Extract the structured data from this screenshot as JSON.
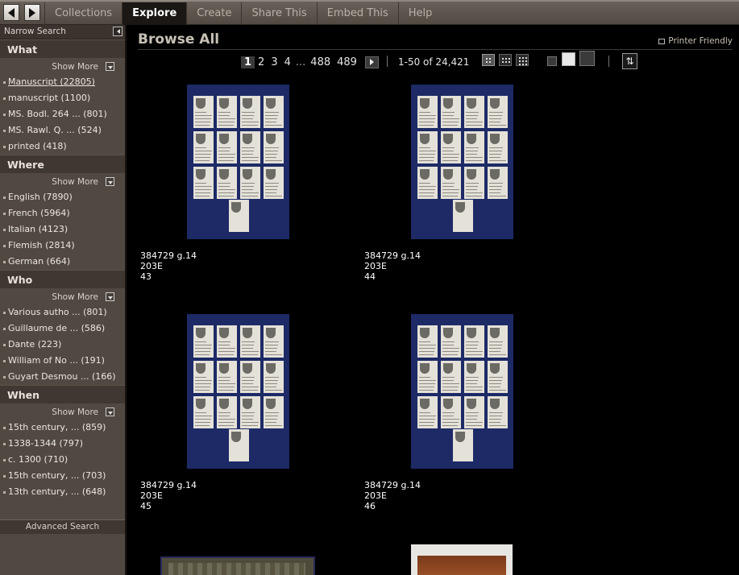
{
  "topbar": {
    "tabs": [
      {
        "label": "Collections",
        "active": false
      },
      {
        "label": "Explore",
        "active": true
      },
      {
        "label": "Create",
        "active": false
      },
      {
        "label": "Share This",
        "active": false
      },
      {
        "label": "Embed This",
        "active": false
      },
      {
        "label": "Help",
        "active": false
      }
    ]
  },
  "sidebar": {
    "header": "Narrow Search",
    "show_more": "Show More",
    "sections": [
      {
        "title": "What",
        "items": [
          "Manuscript (22805)",
          "manuscript (1100)",
          "MS. Bodl. 264 ... (801)",
          "MS. Rawl. Q. ... (524)",
          "printed (418)"
        ]
      },
      {
        "title": "Where",
        "items": [
          "English (7890)",
          "French (5964)",
          "Italian (4123)",
          "Flemish (2814)",
          "German (664)"
        ]
      },
      {
        "title": "Who",
        "items": [
          "Various autho ... (801)",
          "Guillaume de ... (586)",
          "Dante (223)",
          "William of No ... (191)",
          "Guyart Desmou ... (166)"
        ]
      },
      {
        "title": "When",
        "items": [
          "15th century, ... (859)",
          "1338-1344 (797)",
          "c. 1300 (710)",
          "15th century, ... (703)",
          "13th century, ... (648)"
        ]
      }
    ],
    "advanced_search": "Advanced Search"
  },
  "main": {
    "title": "Browse All",
    "printer_friendly": "Printer Friendly",
    "pager": {
      "pages": [
        "1",
        "2",
        "3",
        "4"
      ],
      "ellipsis": "...",
      "last_pages": [
        "488",
        "489"
      ],
      "current": "1"
    },
    "result_count": "1-50 of 24,421",
    "sort_icon": "sort-icon",
    "items": [
      {
        "line1": "384729 g.14",
        "line2": "203E",
        "line3": "43"
      },
      {
        "line1": "384729 g.14",
        "line2": "203E",
        "line3": "44"
      },
      {
        "line1": "384729 g.14",
        "line2": "203E",
        "line3": "45"
      },
      {
        "line1": "384729 g.14",
        "line2": "203E",
        "line3": "46"
      }
    ]
  },
  "colors": {
    "topbar": "#5e554e",
    "sidebar": "#514841",
    "section_header": "#3f3731",
    "background": "#000000",
    "sheet_blue": "#1d2a66"
  }
}
